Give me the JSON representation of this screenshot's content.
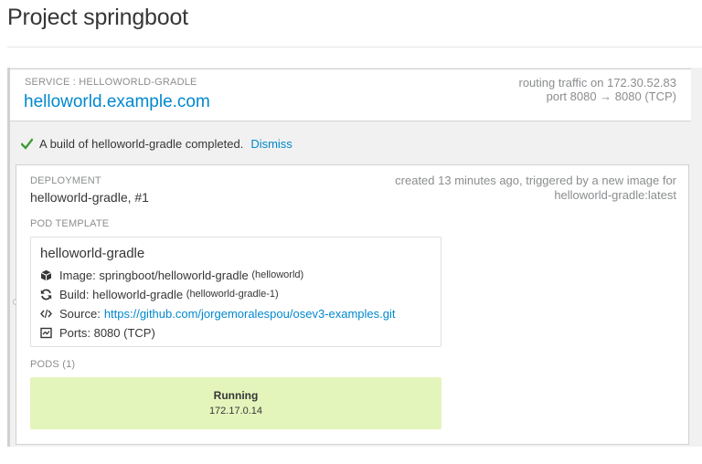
{
  "page": {
    "title": "Project springboot"
  },
  "service": {
    "label": "SERVICE : HELLOWORLD-GRADLE",
    "host": "helloworld.example.com",
    "routing_line1": "routing traffic on 172.30.52.83",
    "routing_line2": "port 8080 → 8080 (TCP)"
  },
  "alert": {
    "message": "A build of helloworld-gradle completed.",
    "dismiss_label": "Dismiss",
    "icon": "check-icon",
    "icon_color": "#3f9c35"
  },
  "deployment": {
    "label": "DEPLOYMENT",
    "name": "helloworld-gradle, #1",
    "meta_line1": "created 13 minutes ago, triggered by a new image for",
    "meta_line2": "helloworld-gradle:latest",
    "pod_template_label": "POD TEMPLATE",
    "pod_template": {
      "name": "helloworld-gradle",
      "image_label": "Image:",
      "image_value": "springboot/helloworld-gradle",
      "image_sub": "(helloworld)",
      "build_label": "Build:",
      "build_value": "helloworld-gradle",
      "build_sub": "(helloworld-gradle-1)",
      "source_label": "Source:",
      "source_link": "https://github.com/jorgemoralespou/osev3-examples.git",
      "ports_label": "Ports:",
      "ports_value": "8080 (TCP)"
    },
    "pods_label": "PODS (1)",
    "pod": {
      "status": "Running",
      "ip": "172.17.0.14",
      "color": "#e4f5bc"
    }
  },
  "colors": {
    "link": "#0088ce",
    "muted": "#8b8d8f",
    "background": "#f1f1f1"
  }
}
